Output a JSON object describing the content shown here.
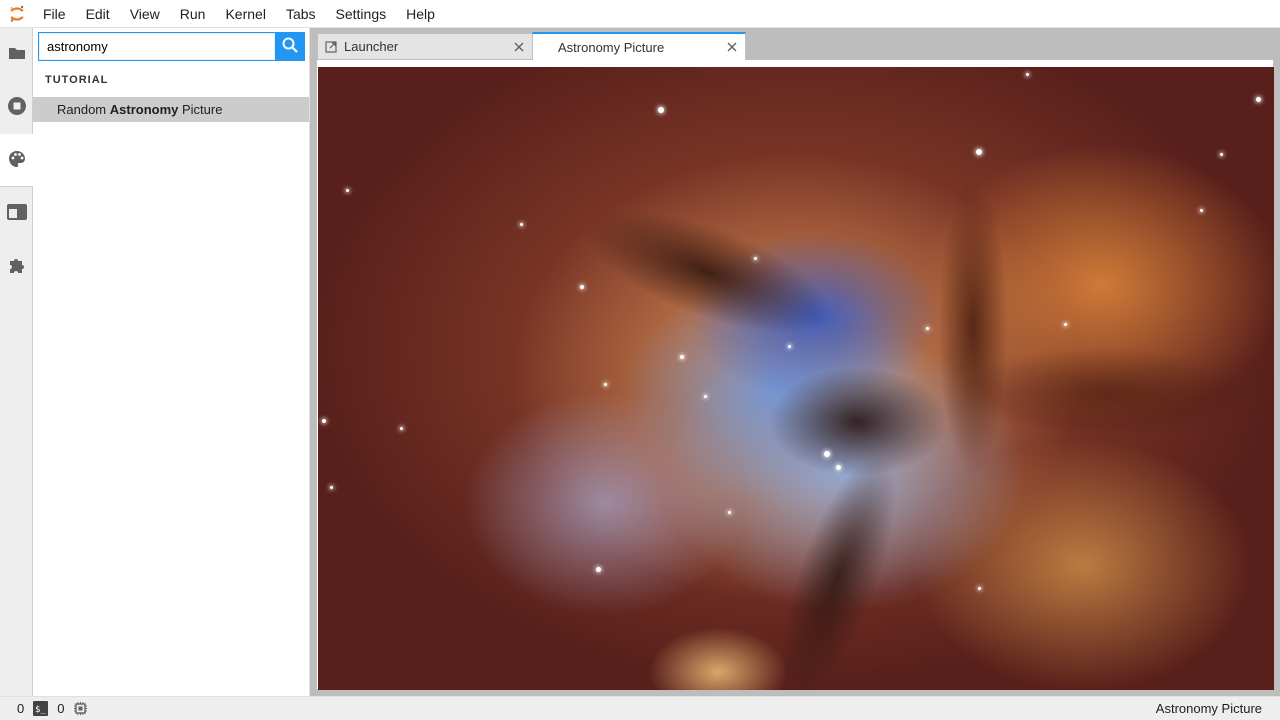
{
  "menubar": {
    "items": [
      "File",
      "Edit",
      "View",
      "Run",
      "Kernel",
      "Tabs",
      "Settings",
      "Help"
    ]
  },
  "sidebar": {
    "icons": [
      "folder-icon",
      "running-sessions-icon",
      "palette-icon",
      "tabs-icon",
      "extension-icon"
    ]
  },
  "command_palette": {
    "search_value": "astronomy",
    "category": "TUTORIAL",
    "result": {
      "prefix": "Random ",
      "match": "Astronomy",
      "suffix": " Picture"
    }
  },
  "tabs": [
    {
      "label": "Launcher",
      "active": false
    },
    {
      "label": "Astronomy Picture",
      "active": true
    }
  ],
  "statusbar": {
    "terminals_count": "0",
    "kernels_count": "0",
    "current_document": "Astronomy Picture"
  },
  "colors": {
    "accent": "#2196f3",
    "selected_row": "#cccccc"
  }
}
